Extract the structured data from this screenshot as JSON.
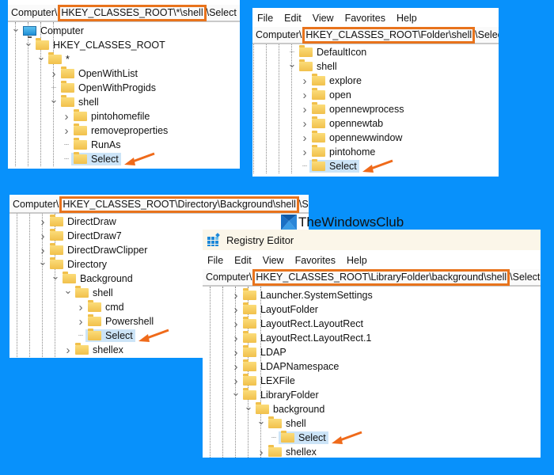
{
  "brand": {
    "text": "TheWindowsClub"
  },
  "colors": {
    "background": "#0891fb",
    "highlight_border": "#e8731c",
    "selection": "#cce4f7",
    "arrow": "#ef6a1a"
  },
  "panel1": {
    "address": {
      "prefix": "Computer\\",
      "highlighted": "HKEY_CLASSES_ROOT\\*\\shell",
      "suffix": "\\Select"
    },
    "tree": [
      {
        "label": "Computer",
        "icon": "computer-icon",
        "expanded": true,
        "level": 0
      },
      {
        "label": "HKEY_CLASSES_ROOT",
        "icon": "folder-icon",
        "expanded": true,
        "level": 1
      },
      {
        "label": "*",
        "icon": "folder-icon",
        "expanded": true,
        "level": 2
      },
      {
        "label": "OpenWithList",
        "icon": "folder-icon",
        "expandable": true,
        "level": 3
      },
      {
        "label": "OpenWithProgids",
        "icon": "folder-icon",
        "expandable": false,
        "level": 3
      },
      {
        "label": "shell",
        "icon": "folder-icon",
        "expanded": true,
        "level": 3
      },
      {
        "label": "pintohomefile",
        "icon": "folder-icon",
        "expandable": true,
        "level": 4
      },
      {
        "label": "removeproperties",
        "icon": "folder-icon",
        "expandable": true,
        "level": 4
      },
      {
        "label": "RunAs",
        "icon": "folder-icon",
        "expandable": false,
        "level": 4
      },
      {
        "label": "Select",
        "icon": "folder-icon",
        "selected": true,
        "level": 4
      }
    ]
  },
  "panel2": {
    "menu": [
      "File",
      "Edit",
      "View",
      "Favorites",
      "Help"
    ],
    "address": {
      "prefix": "Computer\\",
      "highlighted": "HKEY_CLASSES_ROOT\\Folder\\shell",
      "suffix": "\\Select"
    },
    "tree": [
      {
        "label": "DefaultIcon",
        "expandable": false,
        "level": 3
      },
      {
        "label": "shell",
        "expanded": true,
        "level": 3
      },
      {
        "label": "explore",
        "expandable": true,
        "level": 4
      },
      {
        "label": "open",
        "expandable": true,
        "level": 4
      },
      {
        "label": "opennewprocess",
        "expandable": true,
        "level": 4
      },
      {
        "label": "opennewtab",
        "expandable": true,
        "level": 4
      },
      {
        "label": "opennewwindow",
        "expandable": true,
        "level": 4
      },
      {
        "label": "pintohome",
        "expandable": true,
        "level": 4
      },
      {
        "label": "Select",
        "selected": true,
        "level": 4
      }
    ]
  },
  "panel3": {
    "address": {
      "prefix": "Computer\\",
      "highlighted": "HKEY_CLASSES_ROOT\\Directory\\Background\\shell",
      "suffix": "\\Select"
    },
    "tree": [
      {
        "label": "DirectDraw",
        "expandable": true,
        "level": 2
      },
      {
        "label": "DirectDraw7",
        "expandable": true,
        "level": 2
      },
      {
        "label": "DirectDrawClipper",
        "expandable": true,
        "level": 2
      },
      {
        "label": "Directory",
        "expanded": true,
        "level": 2
      },
      {
        "label": "Background",
        "expanded": true,
        "level": 3
      },
      {
        "label": "shell",
        "expanded": true,
        "level": 4
      },
      {
        "label": "cmd",
        "expandable": true,
        "level": 5
      },
      {
        "label": "Powershell",
        "expandable": true,
        "level": 5
      },
      {
        "label": "Select",
        "selected": true,
        "level": 5
      },
      {
        "label": "shellex",
        "expandable": true,
        "level": 4
      }
    ]
  },
  "panel4": {
    "title": "Registry Editor",
    "menu": [
      "File",
      "Edit",
      "View",
      "Favorites",
      "Help"
    ],
    "address": {
      "prefix": "Computer\\",
      "highlighted": "HKEY_CLASSES_ROOT\\LibraryFolder\\background\\shell",
      "suffix": "\\Select"
    },
    "tree": [
      {
        "label": "Launcher.SystemSettings",
        "expandable": true,
        "level": 2
      },
      {
        "label": "LayoutFolder",
        "expandable": true,
        "level": 2
      },
      {
        "label": "LayoutRect.LayoutRect",
        "expandable": true,
        "level": 2
      },
      {
        "label": "LayoutRect.LayoutRect.1",
        "expandable": true,
        "level": 2
      },
      {
        "label": "LDAP",
        "expandable": true,
        "level": 2
      },
      {
        "label": "LDAPNamespace",
        "expandable": true,
        "level": 2
      },
      {
        "label": "LEXFile",
        "expandable": true,
        "level": 2
      },
      {
        "label": "LibraryFolder",
        "expanded": true,
        "level": 2
      },
      {
        "label": "background",
        "expanded": true,
        "level": 3
      },
      {
        "label": "shell",
        "expanded": true,
        "level": 4
      },
      {
        "label": "Select",
        "selected": true,
        "level": 5
      },
      {
        "label": "shellex",
        "expandable": true,
        "level": 4
      }
    ]
  }
}
